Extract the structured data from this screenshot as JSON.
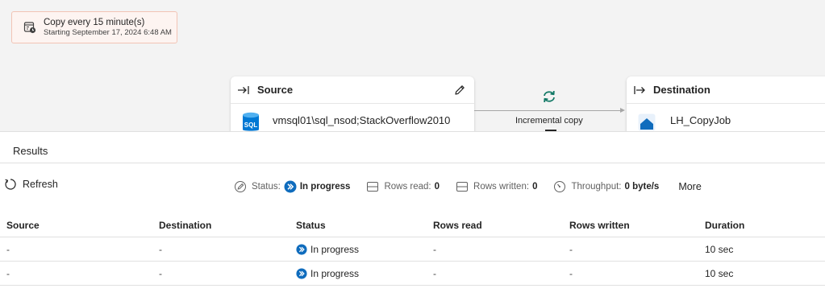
{
  "schedule": {
    "line1": "Copy every 15 minute(s)",
    "line2": "Starting September 17, 2024 6:48 AM",
    "icon": "calendar-clock-icon"
  },
  "source_card": {
    "title": "Source",
    "item": "vmsql01\\sql_nsod;StackOverflow2010",
    "icon": "arrow-right-bar-icon",
    "item_icon": "sql-database-icon"
  },
  "connector": {
    "label": "Incremental copy",
    "icon": "sync-arrows-icon"
  },
  "dest_card": {
    "title": "Destination",
    "item": "LH_CopyJob",
    "icon": "arrow-right-bar-icon",
    "item_icon": "lakehouse-icon"
  },
  "results": {
    "tab_label": "Results",
    "refresh_label": "Refresh",
    "status_label": "Status:",
    "status_value": "In progress",
    "rows_read_label": "Rows read:",
    "rows_read_value": "0",
    "rows_written_label": "Rows written:",
    "rows_written_value": "0",
    "throughput_label": "Throughput:",
    "throughput_value": "0 byte/s",
    "more_label": "More"
  },
  "table": {
    "columns": [
      "Source",
      "Destination",
      "Status",
      "Rows read",
      "Rows written",
      "Duration"
    ],
    "rows": [
      [
        "-",
        "-",
        "In progress",
        "-",
        "-",
        "10 sec"
      ],
      [
        "-",
        "-",
        "In progress",
        "-",
        "-",
        "10 sec"
      ]
    ]
  },
  "colors": {
    "accent": "#0f6cbd",
    "sync_green": "#117865",
    "schedule_bg": "#fdf4f1",
    "schedule_border": "#f2c4b5"
  }
}
